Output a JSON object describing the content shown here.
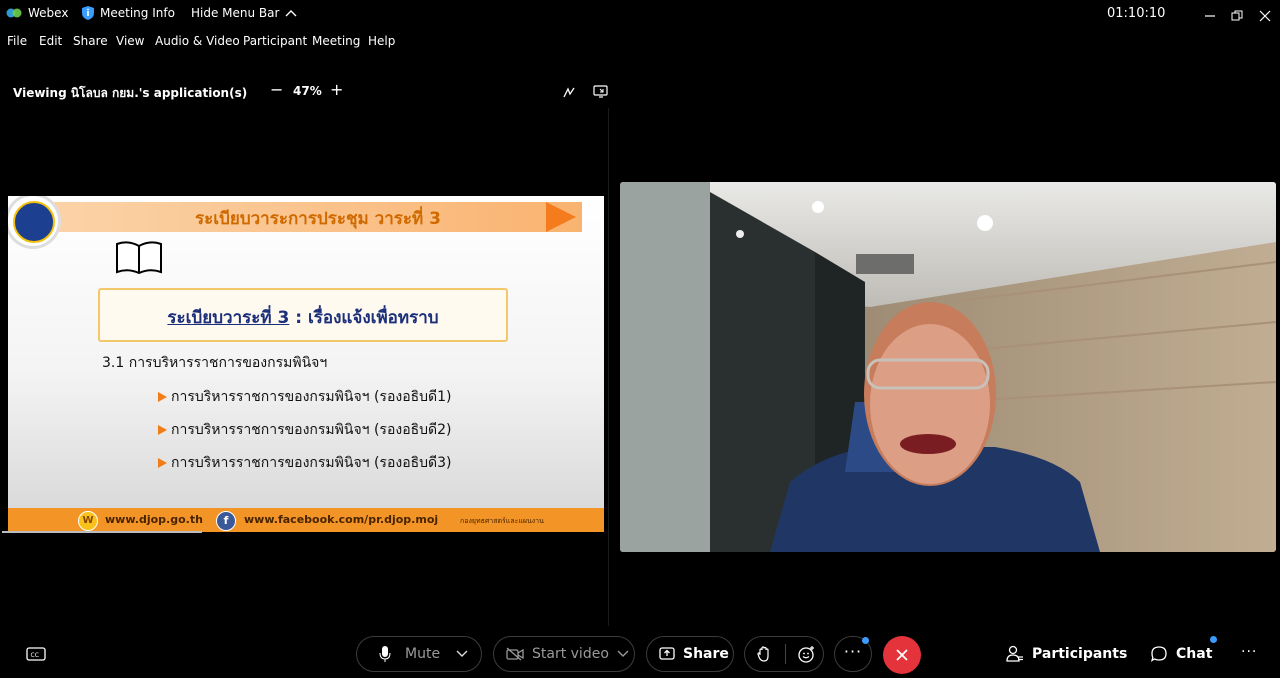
{
  "titlebar": {
    "app_name": "Webex",
    "meeting_info": "Meeting Info",
    "hide_menu": "Hide Menu Bar",
    "timer": "01:10:10"
  },
  "menu": [
    "File",
    "Edit",
    "Share",
    "View",
    "Audio & Video",
    "Participant",
    "Meeting",
    "Help"
  ],
  "viewbar": {
    "viewing_label": "Viewing นิโลบล กยม.'s application(s)",
    "zoom": "47%"
  },
  "slide": {
    "banner_title": "ระเบียบวาระการประชุม วาระที่ 3",
    "box_prefix": "ระเบียบวาระที่ 3",
    "box_suffix": "  : เรื่องแจ้งเพื่อทราบ",
    "heading": "3.1 การบริหารราชการของกรมพินิจฯ",
    "bullets": [
      "การบริหารราชการของกรมพินิจฯ (รองอธิบดี1)",
      "การบริหารราชการของกรมพินิจฯ (รองอธิบดี2)",
      "การบริหารราชการของกรมพินิจฯ (รองอธิบดี3)"
    ],
    "footer_web": "www.djop.go.th",
    "footer_fb": "www.facebook.com/pr.djop.moj",
    "footer_dept": "กองยุทธศาสตร์และแผนงาน",
    "footer_w_letter": "W",
    "footer_f_letter": "f"
  },
  "controls": {
    "mute": "Mute",
    "start_video": "Start video",
    "share": "Share",
    "participants": "Participants",
    "chat": "Chat"
  },
  "colors": {
    "accent_blue": "#3b9cff",
    "end_red": "#e5333b",
    "slide_orange": "#f39526"
  },
  "icons": [
    "webex-logo-icon",
    "shield-info-icon",
    "chevron-up-icon",
    "minimize-icon",
    "restore-icon",
    "close-icon",
    "annotate-icon",
    "popout-icon",
    "captions-icon",
    "microphone-icon",
    "video-off-icon",
    "share-screen-icon",
    "raise-hand-icon",
    "reactions-icon",
    "more-icon",
    "end-call-icon",
    "participants-icon",
    "chat-icon"
  ]
}
